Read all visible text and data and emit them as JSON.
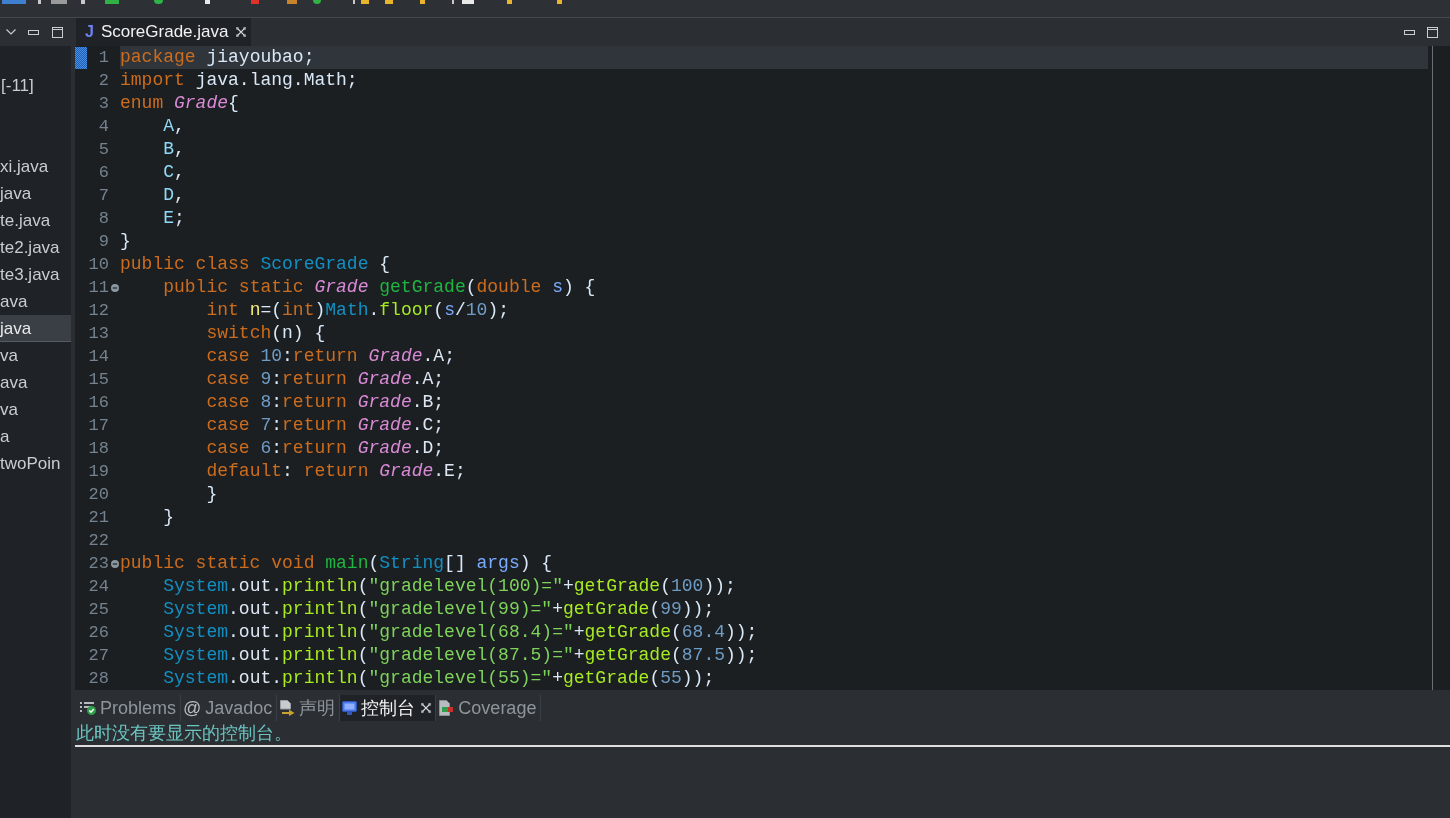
{
  "side_panel": {
    "project": {
      "label": "[-11]"
    },
    "files": [
      {
        "label": "xi.java",
        "selected": false
      },
      {
        "label": "java",
        "selected": false
      },
      {
        "label": "te.java",
        "selected": false
      },
      {
        "label": "te2.java",
        "selected": false
      },
      {
        "label": "te3.java",
        "selected": false
      },
      {
        "label": "ava",
        "selected": false
      },
      {
        "label": "java",
        "selected": true
      },
      {
        "label": "va",
        "selected": false
      },
      {
        "label": "ava",
        "selected": false
      },
      {
        "label": "va",
        "selected": false
      },
      {
        "label": "a",
        "selected": false
      },
      {
        "label": "twoPoin",
        "selected": false
      }
    ]
  },
  "editor": {
    "tabs": [
      {
        "icon_text": "J",
        "label": "ScoreGrade.java",
        "selected": true
      }
    ],
    "lines": [
      {
        "number": "1",
        "current": true,
        "mark": true,
        "foldable": false,
        "tokens": [
          {
            "text": "package ",
            "kind": "keyword"
          },
          {
            "text": "jiayoubao;",
            "kind": "plain"
          }
        ]
      },
      {
        "number": "2",
        "current": false,
        "mark": false,
        "foldable": false,
        "tokens": [
          {
            "text": "import ",
            "kind": "keyword"
          },
          {
            "text": "java.lang.Math;",
            "kind": "plain"
          }
        ]
      },
      {
        "number": "3",
        "current": false,
        "mark": false,
        "foldable": false,
        "tokens": [
          {
            "text": "enum ",
            "kind": "keyword"
          },
          {
            "text": "Grade",
            "kind": "type"
          },
          {
            "text": "{",
            "kind": "plain"
          }
        ]
      },
      {
        "number": "4",
        "current": false,
        "mark": false,
        "foldable": false,
        "tokens": [
          {
            "text": "    A",
            "kind": "constant"
          },
          {
            "text": ",",
            "kind": "plain"
          }
        ]
      },
      {
        "number": "5",
        "current": false,
        "mark": false,
        "foldable": false,
        "tokens": [
          {
            "text": "    B",
            "kind": "constant"
          },
          {
            "text": ",",
            "kind": "plain"
          }
        ]
      },
      {
        "number": "6",
        "current": false,
        "mark": false,
        "foldable": false,
        "tokens": [
          {
            "text": "    C",
            "kind": "constant"
          },
          {
            "text": ",",
            "kind": "plain"
          }
        ]
      },
      {
        "number": "7",
        "current": false,
        "mark": false,
        "foldable": false,
        "tokens": [
          {
            "text": "    D",
            "kind": "constant"
          },
          {
            "text": ",",
            "kind": "plain"
          }
        ]
      },
      {
        "number": "8",
        "current": false,
        "mark": false,
        "foldable": false,
        "tokens": [
          {
            "text": "    E",
            "kind": "constant"
          },
          {
            "text": ";",
            "kind": "plain"
          }
        ]
      },
      {
        "number": "9",
        "current": false,
        "mark": false,
        "foldable": false,
        "tokens": [
          {
            "text": "}",
            "kind": "plain"
          }
        ]
      },
      {
        "number": "10",
        "current": false,
        "mark": false,
        "foldable": false,
        "tokens": [
          {
            "text": "public class ",
            "kind": "keyword"
          },
          {
            "text": "ScoreGrade",
            "kind": "class"
          },
          {
            "text": " {",
            "kind": "plain"
          }
        ]
      },
      {
        "number": "11",
        "current": false,
        "mark": false,
        "foldable": true,
        "tokens": [
          {
            "text": "    public static ",
            "kind": "keyword"
          },
          {
            "text": "Grade ",
            "kind": "type"
          },
          {
            "text": "getGrade",
            "kind": "method"
          },
          {
            "text": "(",
            "kind": "plain"
          },
          {
            "text": "double ",
            "kind": "keyword"
          },
          {
            "text": "s",
            "kind": "parameter"
          },
          {
            "text": ") {",
            "kind": "plain"
          }
        ]
      },
      {
        "number": "12",
        "current": false,
        "mark": false,
        "foldable": false,
        "tokens": [
          {
            "text": "        int ",
            "kind": "keyword"
          },
          {
            "text": "n",
            "kind": "variable"
          },
          {
            "text": "=(",
            "kind": "plain"
          },
          {
            "text": "int",
            "kind": "keyword"
          },
          {
            "text": ")",
            "kind": "plain"
          },
          {
            "text": "Math",
            "kind": "class"
          },
          {
            "text": ".",
            "kind": "plain"
          },
          {
            "text": "floor",
            "kind": "call"
          },
          {
            "text": "(",
            "kind": "plain"
          },
          {
            "text": "s",
            "kind": "parameter"
          },
          {
            "text": "/",
            "kind": "plain"
          },
          {
            "text": "10",
            "kind": "number"
          },
          {
            "text": ");",
            "kind": "plain"
          }
        ]
      },
      {
        "number": "13",
        "current": false,
        "mark": false,
        "foldable": false,
        "tokens": [
          {
            "text": "        switch",
            "kind": "keyword"
          },
          {
            "text": "(n) {",
            "kind": "plain"
          }
        ]
      },
      {
        "number": "14",
        "current": false,
        "mark": false,
        "foldable": false,
        "tokens": [
          {
            "text": "        case ",
            "kind": "keyword"
          },
          {
            "text": "10",
            "kind": "number"
          },
          {
            "text": ":",
            "kind": "plain"
          },
          {
            "text": "return ",
            "kind": "keyword"
          },
          {
            "text": "Grade",
            "kind": "type"
          },
          {
            "text": ".",
            "kind": "plain"
          },
          {
            "text": "A",
            "kind": "field"
          },
          {
            "text": ";",
            "kind": "plain"
          }
        ]
      },
      {
        "number": "15",
        "current": false,
        "mark": false,
        "foldable": false,
        "tokens": [
          {
            "text": "        case ",
            "kind": "keyword"
          },
          {
            "text": "9",
            "kind": "number"
          },
          {
            "text": ":",
            "kind": "plain"
          },
          {
            "text": "return ",
            "kind": "keyword"
          },
          {
            "text": "Grade",
            "kind": "type"
          },
          {
            "text": ".",
            "kind": "plain"
          },
          {
            "text": "A",
            "kind": "field"
          },
          {
            "text": ";",
            "kind": "plain"
          }
        ]
      },
      {
        "number": "16",
        "current": false,
        "mark": false,
        "foldable": false,
        "tokens": [
          {
            "text": "        case ",
            "kind": "keyword"
          },
          {
            "text": "8",
            "kind": "number"
          },
          {
            "text": ":",
            "kind": "plain"
          },
          {
            "text": "return ",
            "kind": "keyword"
          },
          {
            "text": "Grade",
            "kind": "type"
          },
          {
            "text": ".",
            "kind": "plain"
          },
          {
            "text": "B",
            "kind": "field"
          },
          {
            "text": ";",
            "kind": "plain"
          }
        ]
      },
      {
        "number": "17",
        "current": false,
        "mark": false,
        "foldable": false,
        "tokens": [
          {
            "text": "        case ",
            "kind": "keyword"
          },
          {
            "text": "7",
            "kind": "number"
          },
          {
            "text": ":",
            "kind": "plain"
          },
          {
            "text": "return ",
            "kind": "keyword"
          },
          {
            "text": "Grade",
            "kind": "type"
          },
          {
            "text": ".",
            "kind": "plain"
          },
          {
            "text": "C",
            "kind": "field"
          },
          {
            "text": ";",
            "kind": "plain"
          }
        ]
      },
      {
        "number": "18",
        "current": false,
        "mark": false,
        "foldable": false,
        "tokens": [
          {
            "text": "        case ",
            "kind": "keyword"
          },
          {
            "text": "6",
            "kind": "number"
          },
          {
            "text": ":",
            "kind": "plain"
          },
          {
            "text": "return ",
            "kind": "keyword"
          },
          {
            "text": "Grade",
            "kind": "type"
          },
          {
            "text": ".",
            "kind": "plain"
          },
          {
            "text": "D",
            "kind": "field"
          },
          {
            "text": ";",
            "kind": "plain"
          }
        ]
      },
      {
        "number": "19",
        "current": false,
        "mark": false,
        "foldable": false,
        "tokens": [
          {
            "text": "        default",
            "kind": "keyword"
          },
          {
            "text": ": ",
            "kind": "plain"
          },
          {
            "text": "return ",
            "kind": "keyword"
          },
          {
            "text": "Grade",
            "kind": "type"
          },
          {
            "text": ".",
            "kind": "plain"
          },
          {
            "text": "E",
            "kind": "field"
          },
          {
            "text": ";",
            "kind": "plain"
          }
        ]
      },
      {
        "number": "20",
        "current": false,
        "mark": false,
        "foldable": false,
        "tokens": [
          {
            "text": "        }",
            "kind": "plain"
          }
        ]
      },
      {
        "number": "21",
        "current": false,
        "mark": false,
        "foldable": false,
        "tokens": [
          {
            "text": "    }",
            "kind": "plain"
          }
        ]
      },
      {
        "number": "22",
        "current": false,
        "mark": false,
        "foldable": false
      },
      {
        "number": "23",
        "current": false,
        "mark": false,
        "foldable": true,
        "tokens": [
          {
            "text": "public static void ",
            "kind": "keyword"
          },
          {
            "text": "main",
            "kind": "method"
          },
          {
            "text": "(",
            "kind": "plain"
          },
          {
            "text": "String",
            "kind": "class"
          },
          {
            "text": "[] ",
            "kind": "plain"
          },
          {
            "text": "args",
            "kind": "parameter"
          },
          {
            "text": ") {",
            "kind": "plain"
          }
        ]
      },
      {
        "number": "24",
        "current": false,
        "mark": false,
        "foldable": false,
        "tokens": [
          {
            "text": "    System",
            "kind": "class"
          },
          {
            "text": ".",
            "kind": "plain"
          },
          {
            "text": "out",
            "kind": "field"
          },
          {
            "text": ".",
            "kind": "plain"
          },
          {
            "text": "println",
            "kind": "call"
          },
          {
            "text": "(",
            "kind": "plain"
          },
          {
            "text": "\"gradelevel(100)=\"",
            "kind": "string"
          },
          {
            "text": "+",
            "kind": "plain"
          },
          {
            "text": "getGrade",
            "kind": "call"
          },
          {
            "text": "(",
            "kind": "plain"
          },
          {
            "text": "100",
            "kind": "number"
          },
          {
            "text": "));",
            "kind": "plain"
          }
        ]
      },
      {
        "number": "25",
        "current": false,
        "mark": false,
        "foldable": false,
        "tokens": [
          {
            "text": "    System",
            "kind": "class"
          },
          {
            "text": ".",
            "kind": "plain"
          },
          {
            "text": "out",
            "kind": "field"
          },
          {
            "text": ".",
            "kind": "plain"
          },
          {
            "text": "println",
            "kind": "call"
          },
          {
            "text": "(",
            "kind": "plain"
          },
          {
            "text": "\"gradelevel(99)=\"",
            "kind": "string"
          },
          {
            "text": "+",
            "kind": "plain"
          },
          {
            "text": "getGrade",
            "kind": "call"
          },
          {
            "text": "(",
            "kind": "plain"
          },
          {
            "text": "99",
            "kind": "number"
          },
          {
            "text": "));",
            "kind": "plain"
          }
        ]
      },
      {
        "number": "26",
        "current": false,
        "mark": false,
        "foldable": false,
        "tokens": [
          {
            "text": "    System",
            "kind": "class"
          },
          {
            "text": ".",
            "kind": "plain"
          },
          {
            "text": "out",
            "kind": "field"
          },
          {
            "text": ".",
            "kind": "plain"
          },
          {
            "text": "println",
            "kind": "call"
          },
          {
            "text": "(",
            "kind": "plain"
          },
          {
            "text": "\"gradelevel(68.4)=\"",
            "kind": "string"
          },
          {
            "text": "+",
            "kind": "plain"
          },
          {
            "text": "getGrade",
            "kind": "call"
          },
          {
            "text": "(",
            "kind": "plain"
          },
          {
            "text": "68.4",
            "kind": "number"
          },
          {
            "text": "));",
            "kind": "plain"
          }
        ]
      },
      {
        "number": "27",
        "current": false,
        "mark": false,
        "foldable": false,
        "tokens": [
          {
            "text": "    System",
            "kind": "class"
          },
          {
            "text": ".",
            "kind": "plain"
          },
          {
            "text": "out",
            "kind": "field"
          },
          {
            "text": ".",
            "kind": "plain"
          },
          {
            "text": "println",
            "kind": "call"
          },
          {
            "text": "(",
            "kind": "plain"
          },
          {
            "text": "\"gradelevel(87.5)=\"",
            "kind": "string"
          },
          {
            "text": "+",
            "kind": "plain"
          },
          {
            "text": "getGrade",
            "kind": "call"
          },
          {
            "text": "(",
            "kind": "plain"
          },
          {
            "text": "87.5",
            "kind": "number"
          },
          {
            "text": "));",
            "kind": "plain"
          }
        ]
      },
      {
        "number": "28",
        "current": false,
        "mark": false,
        "foldable": false,
        "tokens": [
          {
            "text": "    System",
            "kind": "class"
          },
          {
            "text": ".",
            "kind": "plain"
          },
          {
            "text": "out",
            "kind": "field"
          },
          {
            "text": ".",
            "kind": "plain"
          },
          {
            "text": "println",
            "kind": "call"
          },
          {
            "text": "(",
            "kind": "plain"
          },
          {
            "text": "\"gradelevel(55)=\"",
            "kind": "string"
          },
          {
            "text": "+",
            "kind": "plain"
          },
          {
            "text": "getGrade",
            "kind": "call"
          },
          {
            "text": "(",
            "kind": "plain"
          },
          {
            "text": "55",
            "kind": "number"
          },
          {
            "text": "));",
            "kind": "plain"
          }
        ]
      }
    ]
  },
  "bottom_panel": {
    "tabs": [
      {
        "kind": "problems",
        "label": "Problems",
        "selected": false
      },
      {
        "kind": "javadoc",
        "icon_text": "@",
        "label": "Javadoc",
        "selected": false
      },
      {
        "kind": "declaration",
        "label": "声明",
        "selected": false
      },
      {
        "kind": "console",
        "label": "控制台",
        "selected": true
      },
      {
        "kind": "coverage",
        "label": "Coverage",
        "selected": false
      }
    ],
    "message": "此时没有要显示的控制台。"
  }
}
